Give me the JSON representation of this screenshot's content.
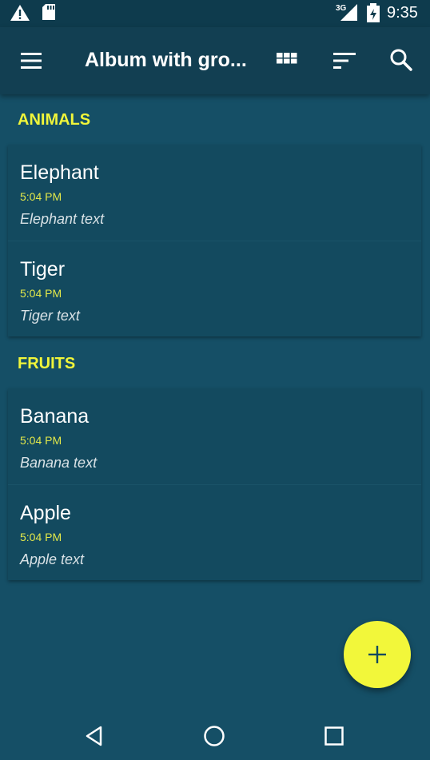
{
  "status_bar": {
    "network": "3G",
    "time": "9:35",
    "icons": [
      "warning-icon",
      "sd-card-icon",
      "signal-icon",
      "battery-icon"
    ]
  },
  "app_bar": {
    "title": "Album with gro...",
    "icons": [
      "menu-icon",
      "grid-view-icon",
      "sort-icon",
      "search-icon"
    ]
  },
  "sections": [
    {
      "header": "ANIMALS",
      "items": [
        {
          "name": "Elephant",
          "time": "5:04 PM",
          "text": "Elephant text"
        },
        {
          "name": "Tiger",
          "time": "5:04 PM",
          "text": "Tiger text"
        }
      ]
    },
    {
      "header": "FRUITS",
      "items": [
        {
          "name": "Banana",
          "time": "5:04 PM",
          "text": "Banana text"
        },
        {
          "name": "Apple",
          "time": "5:04 PM",
          "text": "Apple text"
        }
      ]
    }
  ],
  "fab": {
    "icon": "plus-icon"
  },
  "nav_bar": {
    "icons": [
      "back-icon",
      "home-icon",
      "recents-icon"
    ]
  },
  "colors": {
    "background": "#154f66",
    "app_bar": "#123f52",
    "card": "#134a5f",
    "accent": "#f2f73a"
  }
}
